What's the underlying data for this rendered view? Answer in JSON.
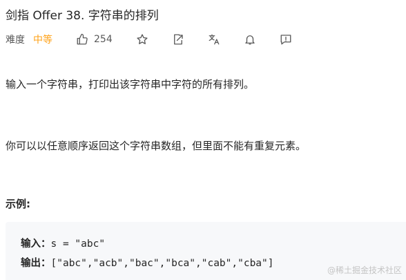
{
  "title": "剑指 Offer 38. 字符串的排列",
  "meta": {
    "difficulty_label": "难度",
    "difficulty": "中等",
    "likes": "254"
  },
  "icons": {
    "like": "thumbs-up-icon",
    "star": "star-icon",
    "share": "share-icon",
    "translate": "translate-icon",
    "notify": "bell-icon",
    "feedback": "feedback-icon"
  },
  "description": {
    "p1": "输入一个字符串，打印出该字符串中字符的所有排列。",
    "p2": "你可以以任意顺序返回这个字符串数组，但里面不能有重复元素。"
  },
  "example": {
    "title": "示例:",
    "input_label": "输入：",
    "input_value": "s = \"abc\"",
    "output_label": "输出：",
    "output_value": "[\"abc\",\"acb\",\"bac\",\"bca\",\"cab\",\"cba\"]"
  },
  "watermark": "@稀土掘金技术社区",
  "colors": {
    "difficulty_medium": "#ffa116",
    "code_background": "#f7f8fa"
  }
}
